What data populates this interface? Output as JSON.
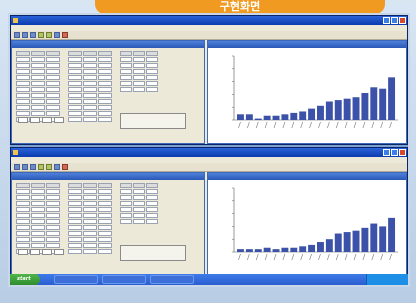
{
  "banner": {
    "title": "구현화면"
  },
  "windows": [
    {
      "title": "",
      "menu": "",
      "toolbar_icons": [
        "new-icon",
        "open-icon",
        "save-icon",
        "chart-icon",
        "table-icon",
        "print-icon",
        "stop-icon"
      ],
      "left_pane_title": "",
      "right_pane_title": "",
      "chart_data": {
        "type": "bar",
        "values": [
          4,
          4,
          1,
          3,
          3,
          4,
          5,
          6,
          8,
          10,
          13,
          14,
          15,
          16,
          19,
          23,
          22,
          30
        ],
        "color": "#3b52a8",
        "ylim": [
          0,
          45
        ],
        "grid": false
      }
    },
    {
      "title": "",
      "menu": "",
      "toolbar_icons": [
        "new-icon",
        "open-icon",
        "save-icon",
        "chart-icon",
        "table-icon",
        "print-icon",
        "stop-icon"
      ],
      "left_pane_title": "",
      "right_pane_title": "",
      "chart_data": {
        "type": "bar",
        "values": [
          2,
          2,
          2,
          3,
          2,
          3,
          3,
          4,
          5,
          7,
          9,
          13,
          14,
          15,
          17,
          20,
          18,
          24
        ],
        "color": "#3b52a8",
        "ylim": [
          0,
          45
        ],
        "grid": false
      }
    }
  ],
  "taskbar": {
    "start_label": "start",
    "items": [
      "",
      "",
      ""
    ],
    "clock": ""
  }
}
